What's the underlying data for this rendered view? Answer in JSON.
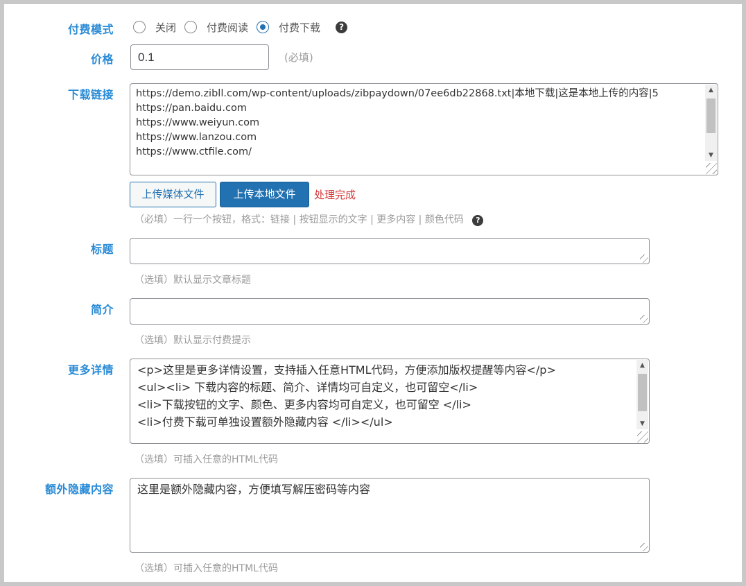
{
  "pay_mode": {
    "label": "付费模式",
    "options": [
      "关闭",
      "付费阅读",
      "付费下载"
    ],
    "selected": "付费下载",
    "help_icon": "question-circle-icon"
  },
  "price": {
    "label": "价格",
    "value": "0.1",
    "hint": "(必填)"
  },
  "download_links": {
    "label": "下载链接",
    "value": "https://demo.zibll.com/wp-content/uploads/zibpaydown/07ee6db22868.txt|本地下载|这是本地上传的内容|5\nhttps://pan.baidu.com\nhttps://www.weiyun.com\nhttps://www.lanzou.com\nhttps://www.ctfile.com/",
    "upload_media_label": "上传媒体文件",
    "upload_local_label": "上传本地文件",
    "status": "处理完成",
    "hint": "（必填）一行一个按钮，格式：链接 | 按钮显示的文字 | 更多内容 | 颜色代码",
    "help_icon": "question-circle-icon",
    "status_color": "#d63638"
  },
  "title": {
    "label": "标题",
    "value": "",
    "hint": "（选填）默认显示文章标题"
  },
  "summary": {
    "label": "简介",
    "value": "",
    "hint": "（选填）默认显示付费提示"
  },
  "more_details": {
    "label": "更多详情",
    "value": "<p>这里是更多详情设置，支持插入任意HTML代码，方便添加版权提醒等内容</p>\n<ul><li> 下载内容的标题、简介、详情均可自定义，也可留空</li>\n<li>下载按钮的文字、颜色、更多内容均可自定义，也可留空 </li>\n<li>付费下载可单独设置额外隐藏内容 </li></ul>",
    "hint": "（选填）可插入任意的HTML代码"
  },
  "hidden_content": {
    "label": "额外隐藏内容",
    "value": "这里是额外隐藏内容，方便填写解压密码等内容",
    "hint": "（选填）可插入任意的HTML代码"
  },
  "colors": {
    "label_blue": "#2a8bd6",
    "primary_button": "#2271b1",
    "hint_gray": "#9a9a9a"
  }
}
